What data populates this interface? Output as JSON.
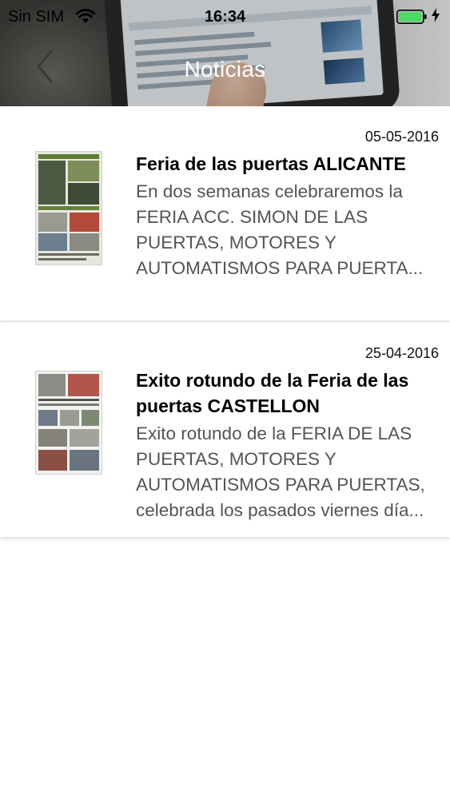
{
  "status_bar": {
    "carrier": "Sin SIM",
    "time": "16:34"
  },
  "nav": {
    "title": "Noticias",
    "back_icon": "chevron-left-icon"
  },
  "colors": {
    "battery": "#4cd964",
    "title_text": "#000000",
    "description_text": "#545454"
  },
  "news": [
    {
      "date": "05-05-2016",
      "title": "Feria de las puertas ALICANTE",
      "description": "En dos semanas celebraremos la\nFERIA ACC. SIMON DE LAS\nPUERTAS, MOTORES Y\nAUTOMATISMOS PARA PUERTA..."
    },
    {
      "date": "25-04-2016",
      "title": "Exito rotundo de la Feria de las puertas CASTELLON",
      "description": "Exito rotundo de la FERIA DE LAS\nPUERTAS, MOTORES Y\nAUTOMATISMOS PARA PUERTAS,\ncelebrada los pasados viernes día..."
    }
  ]
}
